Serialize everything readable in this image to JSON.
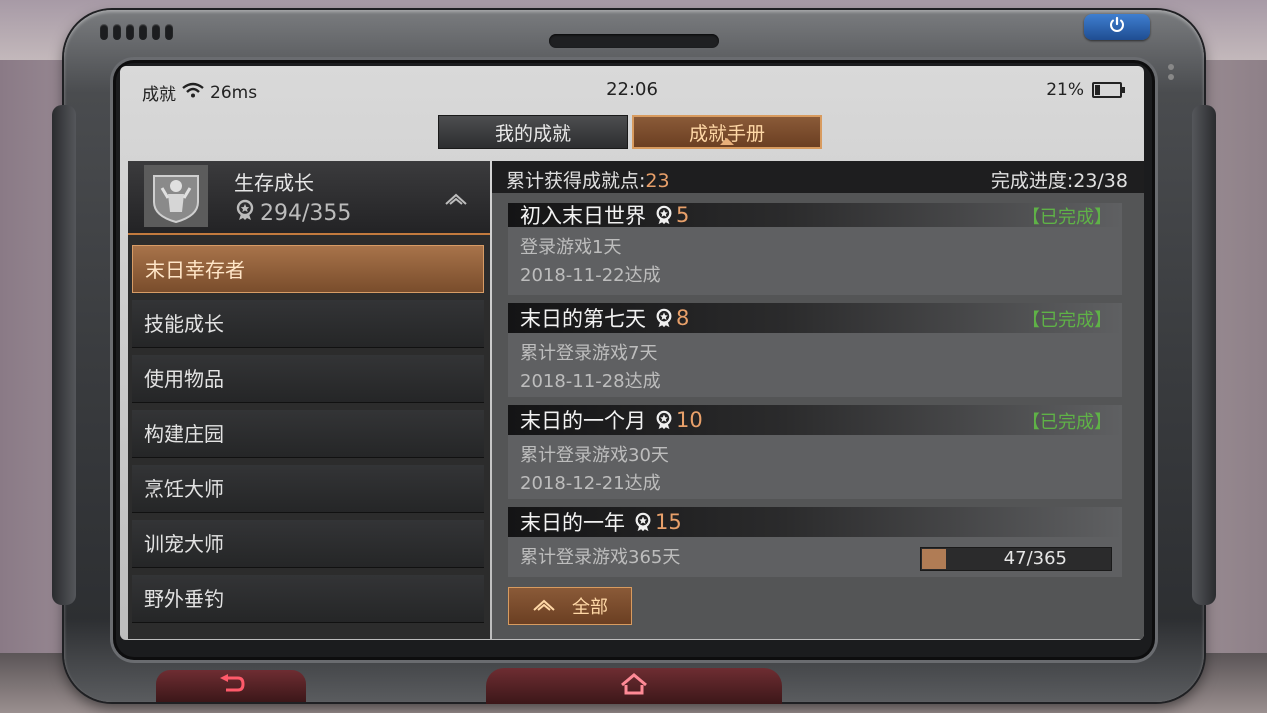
{
  "status": {
    "app_label": "成就",
    "ping": "26ms",
    "time": "22:06",
    "battery": "21%",
    "battery_level": 0.21
  },
  "tabs": [
    {
      "label": "我的成就",
      "active": false
    },
    {
      "label": "成就手册",
      "active": true
    }
  ],
  "category": {
    "title": "生存成长",
    "points": "294/355"
  },
  "categories": [
    {
      "label": "末日幸存者",
      "active": true
    },
    {
      "label": "技能成长",
      "active": false
    },
    {
      "label": "使用物品",
      "active": false
    },
    {
      "label": "构建庄园",
      "active": false
    },
    {
      "label": "烹饪大师",
      "active": false
    },
    {
      "label": "训宠大师",
      "active": false
    },
    {
      "label": "野外垂钓",
      "active": false
    }
  ],
  "summary": {
    "points_label": "累计获得成就点:",
    "points_value": "23",
    "progress_label": "完成进度:23/38"
  },
  "achievements": [
    {
      "title": "初入末日世界",
      "points": "5",
      "status": "【已完成】",
      "desc": "登录游戏1天",
      "date": "2018-11-22达成"
    },
    {
      "title": "末日的第七天",
      "points": "8",
      "status": "【已完成】",
      "desc": "累计登录游戏7天",
      "date": "2018-11-28达成"
    },
    {
      "title": "末日的一个月",
      "points": "10",
      "status": "【已完成】",
      "desc": "累计登录游戏30天",
      "date": "2018-12-21达成"
    },
    {
      "title": "末日的一年",
      "points": "15",
      "status": "",
      "desc": "累计登录游戏365天",
      "progress": "47/365",
      "progress_value": 0.129
    }
  ],
  "buttons": {
    "all_label": "全部"
  },
  "colors": {
    "accent": "#d89b5f",
    "points": "#e8a06a",
    "completed": "#5fb247",
    "power": "#2d6bc2"
  },
  "icons": {
    "wifi": "wifi-icon",
    "battery": "battery-icon",
    "medal": "medal-icon",
    "collapse": "chevron-up-icon",
    "power": "power-icon",
    "back": "back-arrow-icon",
    "home": "home-icon"
  }
}
